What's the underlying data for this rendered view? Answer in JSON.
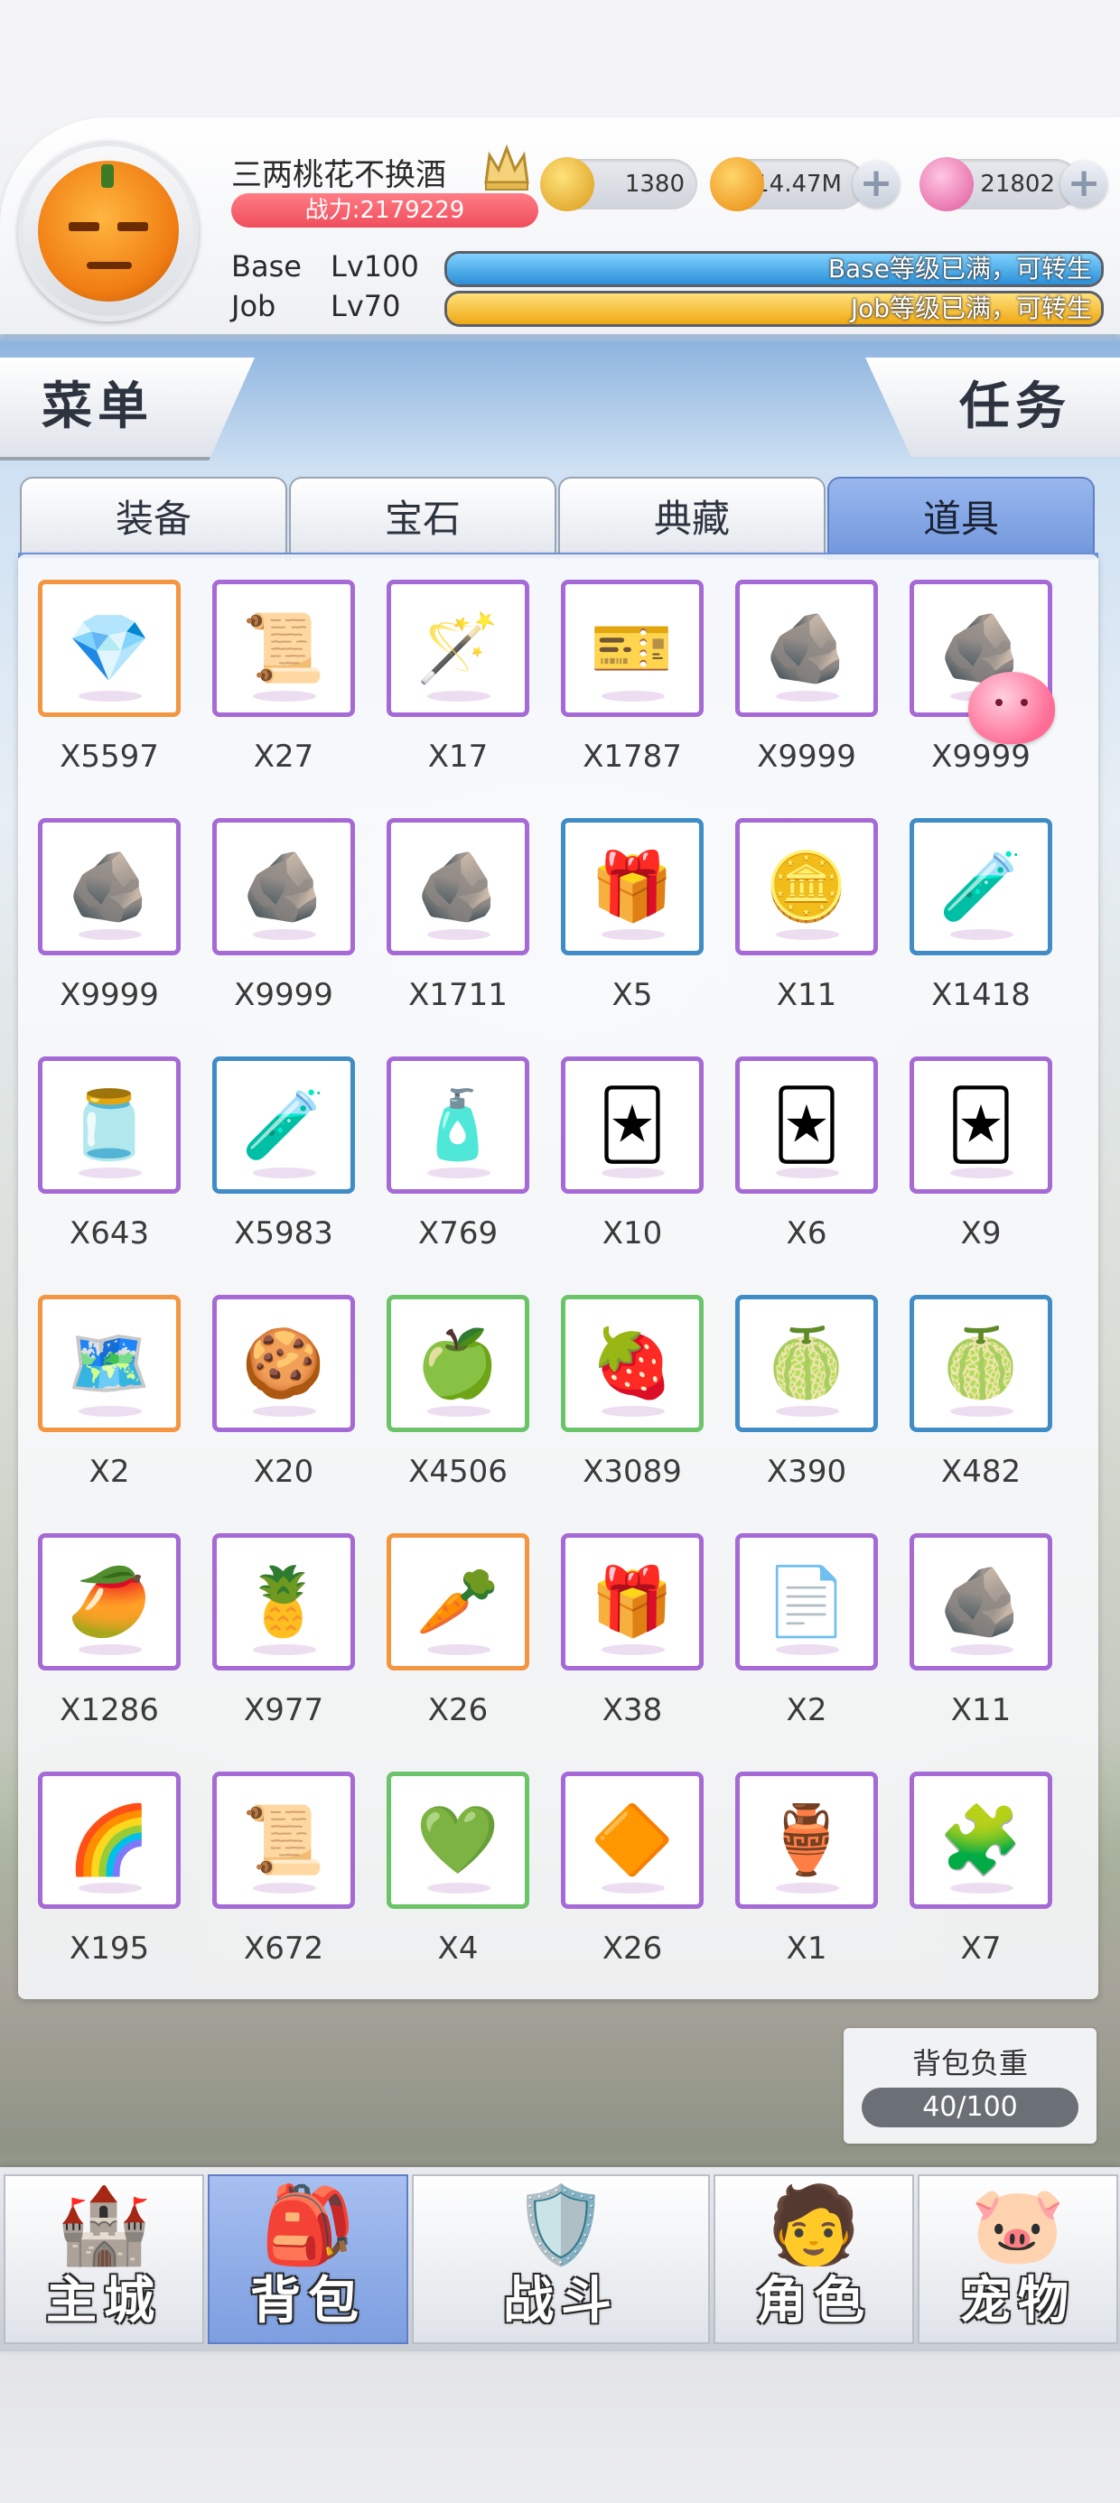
{
  "player": {
    "name": "三两桃花不换酒",
    "power": "战力:2179229",
    "zeny": "1380",
    "gold": "14.47M",
    "gems": "21802",
    "base_label": "Base",
    "base_level": "Lv100",
    "base_status": "Base等级已满，可转生",
    "job_label": "Job",
    "job_level": "Lv70",
    "job_status": "Job等级已满，可转生"
  },
  "buttons": {
    "menu": "菜单",
    "task": "任务"
  },
  "tabs": [
    {
      "label": "装备",
      "active": false
    },
    {
      "label": "宝石",
      "active": false
    },
    {
      "label": "典藏",
      "active": false
    },
    {
      "label": "道具",
      "active": true
    }
  ],
  "items": [
    {
      "qty": "X5597",
      "icon": "crystal-icon",
      "glyph": "💎",
      "rarity": "orange"
    },
    {
      "qty": "X27",
      "icon": "bat-scroll-icon",
      "glyph": "📜",
      "rarity": "purple"
    },
    {
      "qty": "X17",
      "icon": "magic-wand-icon",
      "glyph": "🪄",
      "rarity": "purple"
    },
    {
      "qty": "X1787",
      "icon": "ticket-icon",
      "glyph": "🎫",
      "rarity": "purple"
    },
    {
      "qty": "X9999",
      "icon": "ore-icon",
      "glyph": "🪨",
      "rarity": "purple"
    },
    {
      "qty": "X9999",
      "icon": "ore-icon",
      "glyph": "🪨",
      "rarity": "purple"
    },
    {
      "qty": "X9999",
      "icon": "ore-icon",
      "glyph": "🪨",
      "rarity": "purple"
    },
    {
      "qty": "X9999",
      "icon": "ore-icon",
      "glyph": "🪨",
      "rarity": "purple"
    },
    {
      "qty": "X1711",
      "icon": "ore-icon",
      "glyph": "🪨",
      "rarity": "purple"
    },
    {
      "qty": "X5",
      "icon": "treasure-box-icon",
      "glyph": "🎁",
      "rarity": "blue"
    },
    {
      "qty": "X11",
      "icon": "medal-coin-icon",
      "glyph": "🪙",
      "rarity": "purple"
    },
    {
      "qty": "X1418",
      "icon": "test-tube-icon",
      "glyph": "🧪",
      "rarity": "blue"
    },
    {
      "qty": "X643",
      "icon": "jar-icon",
      "glyph": "🫙",
      "rarity": "purple"
    },
    {
      "qty": "X5983",
      "icon": "potion-tube-icon",
      "glyph": "🧪",
      "rarity": "blue"
    },
    {
      "qty": "X769",
      "icon": "potion-bottle-icon",
      "glyph": "🧴",
      "rarity": "purple"
    },
    {
      "qty": "X10",
      "icon": "card-pack-icon",
      "glyph": "🃏",
      "rarity": "purple"
    },
    {
      "qty": "X6",
      "icon": "card-pack-icon",
      "glyph": "🃏",
      "rarity": "purple"
    },
    {
      "qty": "X9",
      "icon": "card-pack-icon",
      "glyph": "🃏",
      "rarity": "purple"
    },
    {
      "qty": "X2",
      "icon": "map-icon",
      "glyph": "🗺️",
      "rarity": "orange"
    },
    {
      "qty": "X20",
      "icon": "cookie-icon",
      "glyph": "🍪",
      "rarity": "purple"
    },
    {
      "qty": "X4506",
      "icon": "green-apple-icon",
      "glyph": "🍏",
      "rarity": "green"
    },
    {
      "qty": "X3089",
      "icon": "strawberry-icon",
      "glyph": "🍓",
      "rarity": "green"
    },
    {
      "qty": "X390",
      "icon": "melon-icon",
      "glyph": "🍈",
      "rarity": "blue"
    },
    {
      "qty": "X482",
      "icon": "melon-icon",
      "glyph": "🍈",
      "rarity": "blue"
    },
    {
      "qty": "X1286",
      "icon": "mango-icon",
      "glyph": "🥭",
      "rarity": "purple"
    },
    {
      "qty": "X977",
      "icon": "durian-icon",
      "glyph": "🍍",
      "rarity": "purple"
    },
    {
      "qty": "X26",
      "icon": "carrot-icon",
      "glyph": "🥕",
      "rarity": "orange"
    },
    {
      "qty": "X38",
      "icon": "gift-box-icon",
      "glyph": "🎁",
      "rarity": "purple"
    },
    {
      "qty": "X2",
      "icon": "letter-icon",
      "glyph": "📄",
      "rarity": "purple"
    },
    {
      "qty": "X11",
      "icon": "dark-ore-icon",
      "glyph": "🪨",
      "rarity": "purple"
    },
    {
      "qty": "X195",
      "icon": "rainbow-stone-icon",
      "glyph": "🌈",
      "rarity": "purple"
    },
    {
      "qty": "X672",
      "icon": "parchment-icon",
      "glyph": "📜",
      "rarity": "purple"
    },
    {
      "qty": "X4",
      "icon": "green-crystal-icon",
      "glyph": "💚",
      "rarity": "green"
    },
    {
      "qty": "X26",
      "icon": "gold-crystal-icon",
      "glyph": "🔶",
      "rarity": "purple"
    },
    {
      "qty": "X1",
      "icon": "bottle-icon",
      "glyph": "🏺",
      "rarity": "purple"
    },
    {
      "qty": "X7",
      "icon": "green-puzzle-icon",
      "glyph": "🧩",
      "rarity": "purple"
    }
  ],
  "weight": {
    "label": "背包负重",
    "value": "40/100"
  },
  "nav": [
    {
      "label": "主城",
      "icon": "castle-icon",
      "glyph": "🏰",
      "active": false
    },
    {
      "label": "背包",
      "icon": "backpack-icon",
      "glyph": "🎒",
      "active": true
    },
    {
      "label": "战斗",
      "icon": "battle-shield-icon",
      "glyph": "🛡️",
      "active": false
    },
    {
      "label": "角色",
      "icon": "character-icon",
      "glyph": "🧑",
      "active": false
    },
    {
      "label": "宠物",
      "icon": "pet-icon",
      "glyph": "🐷",
      "active": false
    }
  ],
  "colors": {
    "base_bar": "#3aa6e8",
    "job_bar": "#f5c03a",
    "power_badge": "#ef4d5c",
    "tab_active": "#7196dc"
  }
}
